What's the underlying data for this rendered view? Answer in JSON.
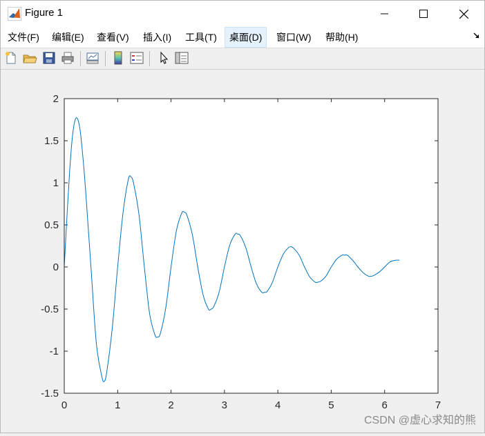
{
  "window": {
    "title": "Figure 1",
    "controls": [
      "minimize",
      "maximize",
      "close"
    ]
  },
  "menubar": {
    "items": [
      {
        "label": "文件(F)",
        "active": false
      },
      {
        "label": "编辑(E)",
        "active": false
      },
      {
        "label": "查看(V)",
        "active": false
      },
      {
        "label": "插入(I)",
        "active": false
      },
      {
        "label": "工具(T)",
        "active": false
      },
      {
        "label": "桌面(D)",
        "active": true
      },
      {
        "label": "窗口(W)",
        "active": false
      },
      {
        "label": "帮助(H)",
        "active": false
      }
    ],
    "overflow_icon": "dock-arrow-icon"
  },
  "toolbar": {
    "icons": [
      "new-figure-icon",
      "open-file-icon",
      "save-icon",
      "print-icon",
      "link-plot-icon",
      "insert-colorbar-icon",
      "insert-legend-icon",
      "edit-plot-icon",
      "property-inspector-icon"
    ]
  },
  "chart_data": {
    "type": "line",
    "title": "",
    "xlabel": "",
    "ylabel": "",
    "xlim": [
      0,
      7
    ],
    "ylim": [
      -1.5,
      2
    ],
    "xticks": [
      0,
      1,
      2,
      3,
      4,
      5,
      6,
      7
    ],
    "yticks": [
      -1.5,
      -1,
      -0.5,
      0,
      0.5,
      1,
      1.5,
      2
    ],
    "xtick_labels": [
      "0",
      "1",
      "2",
      "3",
      "4",
      "5",
      "6",
      "7"
    ],
    "ytick_labels": [
      "-1.5",
      "-1",
      "-0.5",
      "0",
      "0.5",
      "1",
      "1.5",
      "2"
    ],
    "grid": false,
    "line_color": "#0072bd",
    "series": [
      {
        "x": [
          0,
          0.05,
          0.1,
          0.15,
          0.2,
          0.25,
          0.3,
          0.35,
          0.4,
          0.5,
          0.6,
          0.7,
          0.75,
          0.8,
          0.9,
          1.0,
          1.1,
          1.2,
          1.25,
          1.3,
          1.4,
          1.5,
          1.6,
          1.7,
          1.75,
          1.8,
          1.9,
          2.0,
          2.1,
          2.2,
          2.25,
          2.3,
          2.4,
          2.5,
          2.6,
          2.7,
          2.75,
          2.8,
          2.9,
          3.0,
          3.1,
          3.2,
          3.25,
          3.3,
          3.4,
          3.5,
          3.6,
          3.7,
          3.75,
          3.8,
          3.9,
          4.0,
          4.1,
          4.2,
          4.25,
          4.3,
          4.4,
          4.5,
          4.6,
          4.7,
          4.75,
          4.8,
          4.9,
          5.0,
          5.1,
          5.2,
          5.25,
          5.3,
          5.4,
          5.5,
          5.6,
          5.7,
          5.75,
          5.8,
          5.9,
          6.0,
          6.1,
          6.2,
          6.28
        ],
        "y": [
          0,
          0.59,
          1.13,
          1.53,
          1.74,
          1.76,
          1.61,
          1.3,
          0.91,
          0,
          -0.9,
          -1.29,
          -1.36,
          -1.23,
          -0.72,
          0,
          0.64,
          1.04,
          1.07,
          0.99,
          0.62,
          0,
          -0.56,
          -0.81,
          -0.83,
          -0.79,
          -0.49,
          0,
          0.43,
          0.64,
          0.65,
          0.61,
          0.38,
          0,
          -0.33,
          -0.5,
          -0.5,
          -0.47,
          -0.3,
          0,
          0.26,
          0.39,
          0.39,
          0.37,
          0.23,
          0,
          -0.2,
          -0.3,
          -0.3,
          -0.29,
          -0.18,
          0,
          0.15,
          0.23,
          0.24,
          0.22,
          0.14,
          0,
          -0.12,
          -0.18,
          -0.18,
          -0.17,
          -0.11,
          0,
          0.09,
          0.14,
          0.14,
          0.14,
          0.08,
          0,
          -0.07,
          -0.11,
          -0.11,
          -0.1,
          -0.06,
          0,
          0.06,
          0.08,
          0.08
        ]
      }
    ]
  },
  "watermark": "CSDN @虚心求知的熊"
}
